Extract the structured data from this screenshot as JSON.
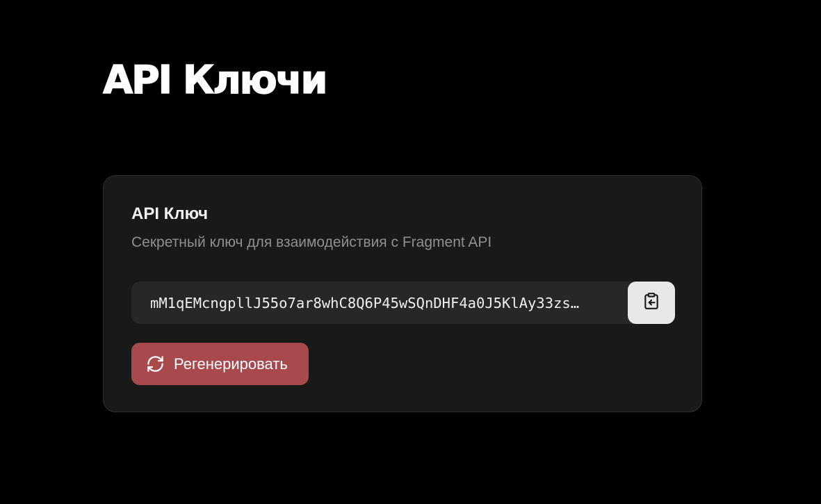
{
  "page": {
    "title": "API Ключи"
  },
  "card": {
    "title": "API Ключ",
    "description": "Секретный ключ для взаимодействия с Fragment API",
    "api_key": "mM1qEMcngpllJ55o7ar8whC8Q6P45wSQnDHF4a0J5KlAy33zs…",
    "copy_icon": "clipboard-copy-icon",
    "regenerate_icon": "refresh-icon",
    "regenerate_label": "Регенерировать"
  },
  "colors": {
    "background": "#000000",
    "card_background": "#191919",
    "field_background": "#272727",
    "copy_button_background": "#e8e8e8",
    "regenerate_button_background": "#a84a4d"
  }
}
